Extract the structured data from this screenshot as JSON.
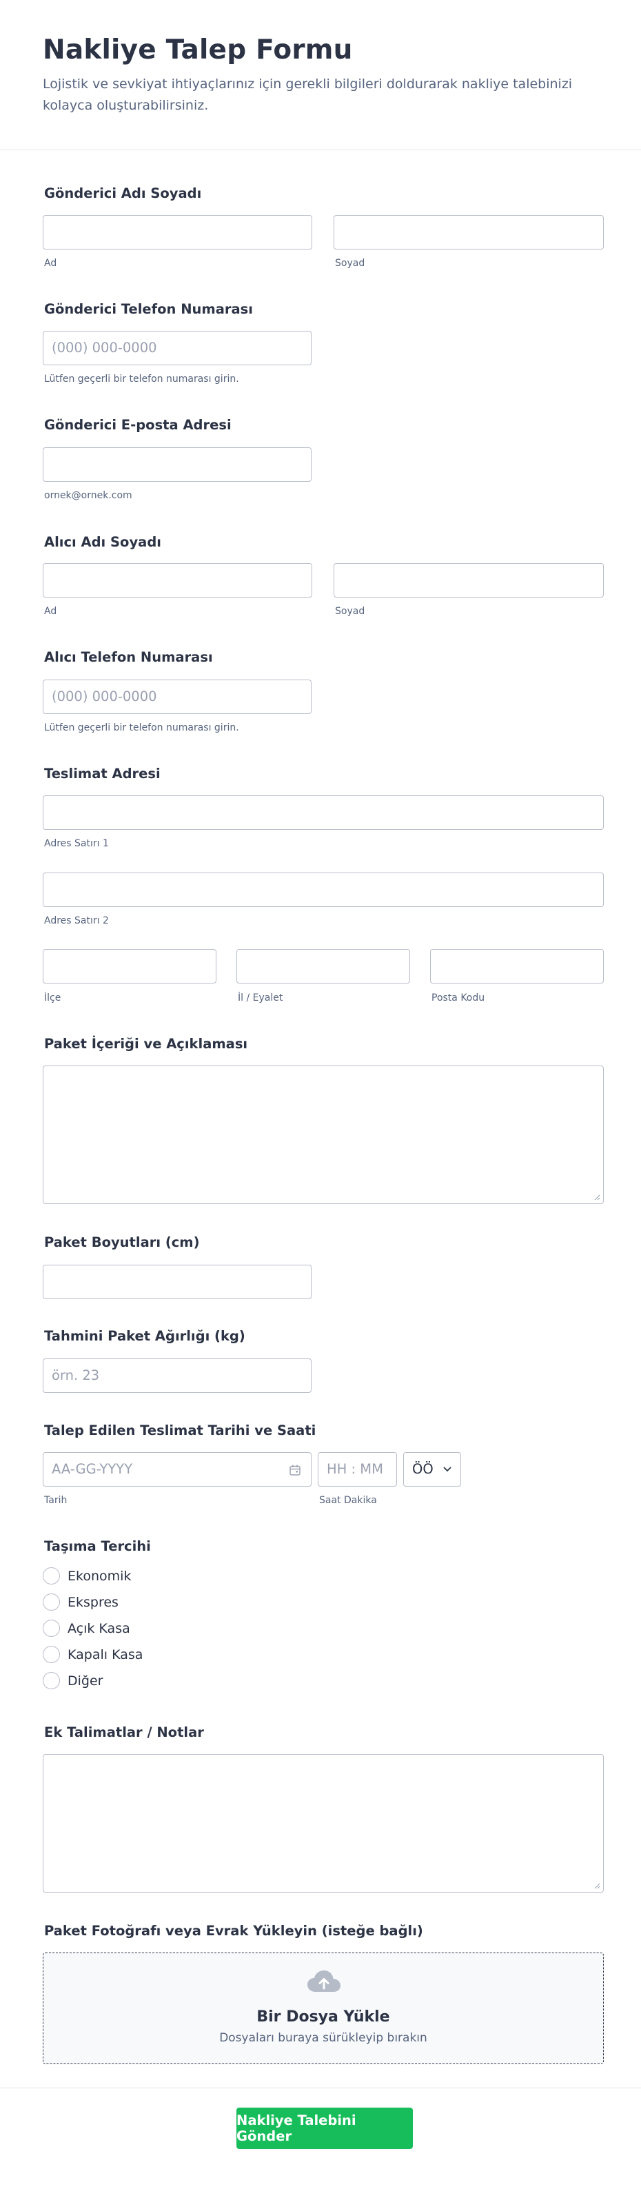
{
  "header": {
    "title": "Nakliye Talep Formu",
    "description": "Lojistik ve sevkiyat ihtiyaçlarınız için gerekli bilgileri doldurarak nakliye talebinizi kolayca oluşturabilirsiniz."
  },
  "sender_name": {
    "label": "Gönderici Adı Soyadı",
    "first_sub": "Ad",
    "last_sub": "Soyad"
  },
  "sender_phone": {
    "label": "Gönderici Telefon Numarası",
    "placeholder": "(000) 000-0000",
    "hint": "Lütfen geçerli bir telefon numarası girin."
  },
  "sender_email": {
    "label": "Gönderici E-posta Adresi",
    "hint": "ornek@ornek.com"
  },
  "receiver_name": {
    "label": "Alıcı Adı Soyadı",
    "first_sub": "Ad",
    "last_sub": "Soyad"
  },
  "receiver_phone": {
    "label": "Alıcı Telefon Numarası",
    "placeholder": "(000) 000-0000",
    "hint": "Lütfen geçerli bir telefon numarası girin."
  },
  "address": {
    "label": "Teslimat Adresi",
    "line1_sub": "Adres Satırı 1",
    "line2_sub": "Adres Satırı 2",
    "district_sub": "İlçe",
    "province_sub": "İl / Eyalet",
    "postal_sub": "Posta Kodu"
  },
  "package_content": {
    "label": "Paket İçeriği ve Açıklaması"
  },
  "package_dimensions": {
    "label": "Paket Boyutları (cm)"
  },
  "package_weight": {
    "label": "Tahmini Paket Ağırlığı (kg)",
    "placeholder": "örn. 23"
  },
  "delivery_datetime": {
    "label": "Talep Edilen Teslimat Tarihi ve Saati",
    "date_placeholder": "AA-GG-YYYY",
    "time_placeholder": "HH : MM",
    "ampm_value": "ÖÖ",
    "date_sub": "Tarih",
    "time_sub": "Saat Dakika"
  },
  "transport": {
    "label": "Taşıma Tercihi",
    "options": [
      "Ekonomik",
      "Ekspres",
      "Açık Kasa",
      "Kapalı Kasa",
      "Diğer"
    ]
  },
  "notes": {
    "label": "Ek Talimatlar / Notlar"
  },
  "upload": {
    "label": "Paket Fotoğrafı veya Evrak Yükleyin (isteğe bağlı)",
    "title": "Bir Dosya Yükle",
    "subtitle": "Dosyaları buraya sürükleyip bırakın"
  },
  "submit": {
    "label": "Nakliye Talebini Gönder"
  },
  "colors": {
    "accent": "#18bd5b",
    "text": "#2c3345",
    "muted": "#57647e",
    "border": "#b8bdc9"
  }
}
